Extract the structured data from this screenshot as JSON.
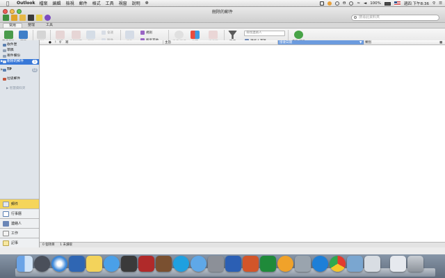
{
  "menubar": {
    "app_name": "Outlook",
    "items": [
      "檔案",
      "編輯",
      "檢視",
      "郵件",
      "格式",
      "工具",
      "視窗",
      "說明"
    ],
    "clock": "週四 下午8:36",
    "battery": "100%"
  },
  "window": {
    "title": "刪除的郵件",
    "search_placeholder": "搜尋此資料夾"
  },
  "ribbon_tabs": [
    "常用",
    "整理",
    "工具"
  ],
  "ribbon": {
    "new_email": "電子郵件",
    "new_items": "新項",
    "delete": "刪除",
    "reply": "回覆",
    "reply_all": "全部回覆",
    "forward": "轉寄",
    "meeting": "會議",
    "attachment": "附件",
    "move": "移動",
    "rules": "規則",
    "move_other": "移至其他",
    "read_unread": "未讀/已讀",
    "categorize": "分類",
    "follow_up": "待處理",
    "filter": "篩選",
    "find_contact": "尋找連絡人",
    "address_book": "連絡人選擇",
    "send_receive": "傳送/接收"
  },
  "folders": [
    {
      "label": "收件匣",
      "color": "#5a7fb0",
      "selected": false
    },
    {
      "label": "草稿",
      "color": "#8fa0b5",
      "selected": false
    },
    {
      "label": "寄件備份",
      "color": "#8fa0b5",
      "selected": false
    },
    {
      "label": "刪除的郵件",
      "color": "#e0e6ef",
      "selected": true,
      "count": "1"
    }
  ],
  "account_group": {
    "label": "TP",
    "count": "12"
  },
  "junk": {
    "label": "垃圾郵件"
  },
  "saved_search": "智慧資料夾",
  "nav": [
    {
      "label": "郵件",
      "selected": true
    },
    {
      "label": "行事曆",
      "selected": false
    },
    {
      "label": "連絡人",
      "selected": false
    },
    {
      "label": "工作",
      "selected": false
    },
    {
      "label": "記事",
      "selected": false
    }
  ],
  "list_columns": {
    "subject_icons": "!",
    "from": "寄",
    "subject": "主旨",
    "received": "接收日期",
    "category": "類別"
  },
  "status": {
    "items": "0 個項目",
    "unread": "1 未讀取"
  },
  "colors": {
    "selection": "#3878d8",
    "nav_selected": "#f5d55a"
  }
}
